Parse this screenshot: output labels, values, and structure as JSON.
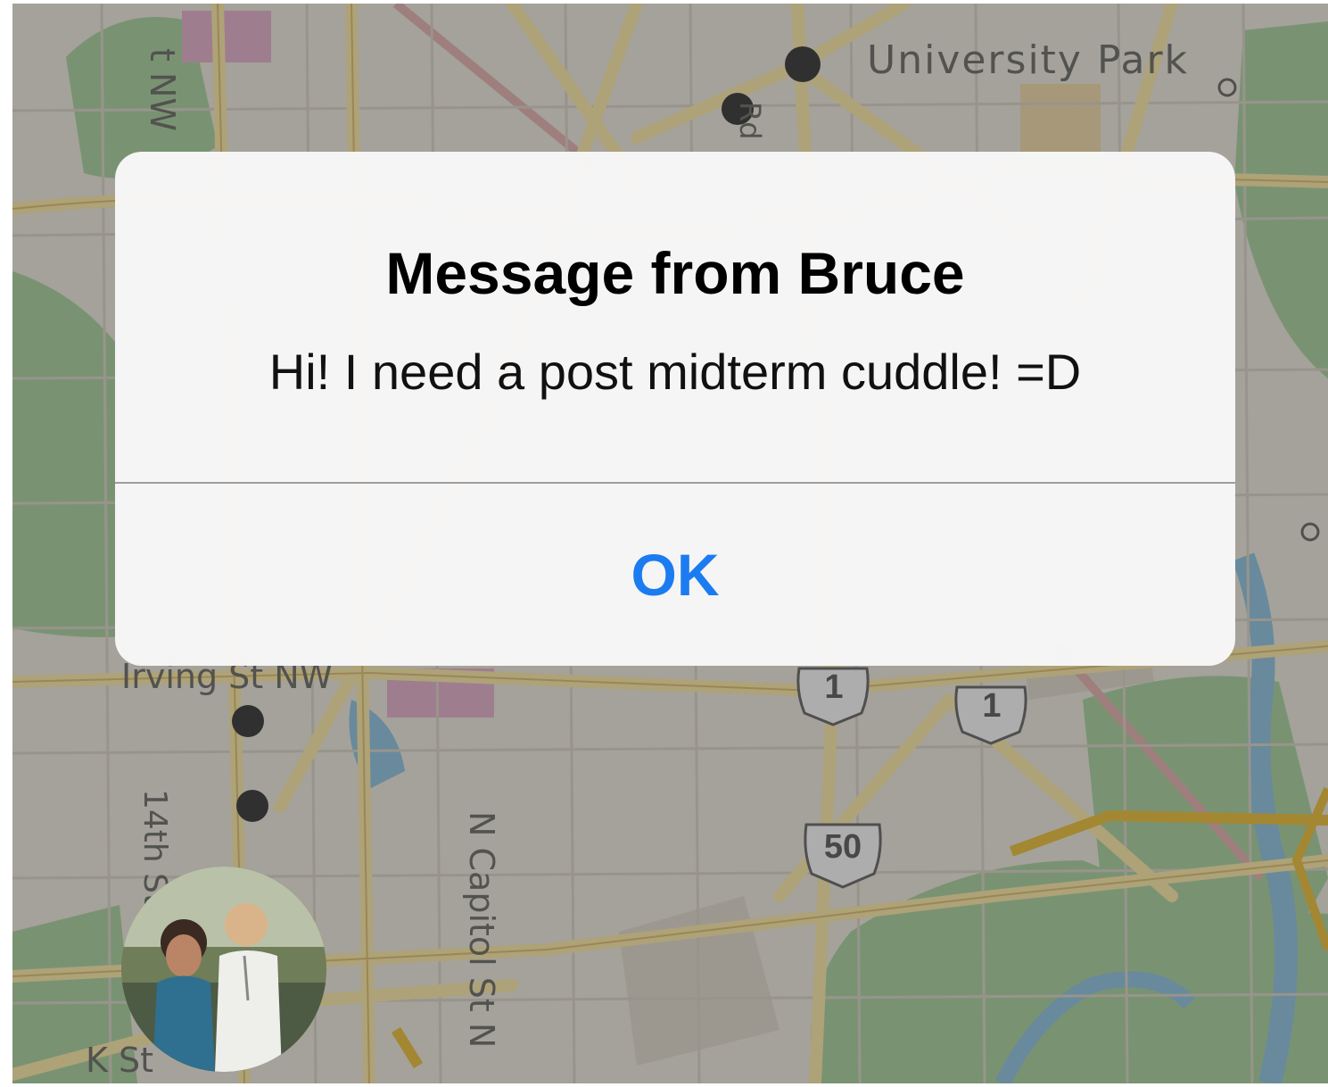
{
  "alert": {
    "title": "Message from Bruce",
    "message": "Hi! I need a post midterm cuddle! =D",
    "ok_label": "OK"
  },
  "map": {
    "labels": {
      "university_park": "University Park",
      "irving_st": "Irving St NW",
      "fourteenth_st": "14th St",
      "n_capitol_st": "N Capitol St N",
      "k_st": "K St",
      "nw_fragment": "t NW",
      "rd_fragment": "Rd"
    },
    "route_shields": [
      "1",
      "1",
      "50"
    ]
  },
  "colors": {
    "accent": "#1a7cf0",
    "road": "#e9c46a",
    "highway": "#e2b225",
    "park": "#9cc78f",
    "water": "#7fb7d6",
    "land": "#e3dfd3"
  }
}
